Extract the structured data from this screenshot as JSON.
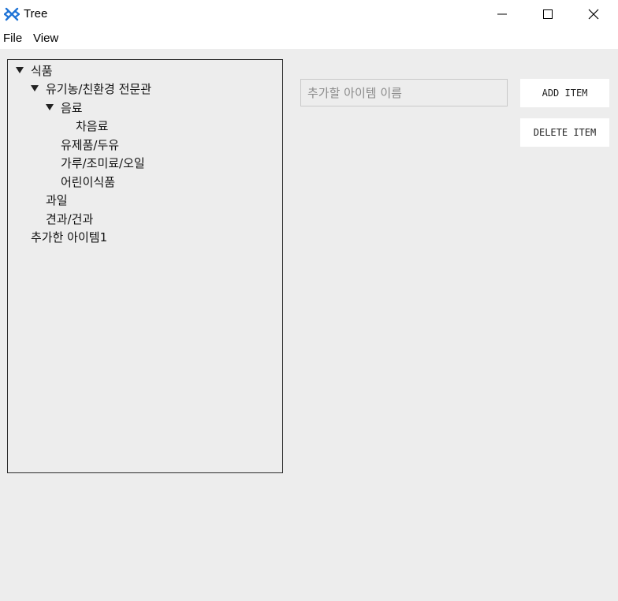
{
  "window": {
    "title": "Tree",
    "app_icon": "tree-app-icon",
    "controls": [
      "minimize-icon",
      "maximize-icon",
      "close-icon"
    ]
  },
  "menu": {
    "file": "File",
    "view": "View"
  },
  "tree": {
    "nodes": [
      {
        "label": "식품",
        "expanded": true,
        "level": 0
      },
      {
        "label": "유기농/친환경 전문관",
        "expanded": true,
        "level": 1
      },
      {
        "label": "음료",
        "expanded": true,
        "level": 2
      },
      {
        "label": "차음료",
        "level": 3
      },
      {
        "label": "유제품/두유",
        "level": 2
      },
      {
        "label": "가루/조미료/오일",
        "level": 2
      },
      {
        "label": "어린이식품",
        "level": 2
      },
      {
        "label": "과일",
        "level": 1
      },
      {
        "label": "견과/건과",
        "level": 1
      },
      {
        "label": "추가한 아이템1",
        "level": 0
      }
    ]
  },
  "form": {
    "input_placeholder": "추가할 아이템 이름",
    "input_value": "",
    "add_label": "ADD ITEM",
    "delete_label": "DELETE ITEM"
  }
}
